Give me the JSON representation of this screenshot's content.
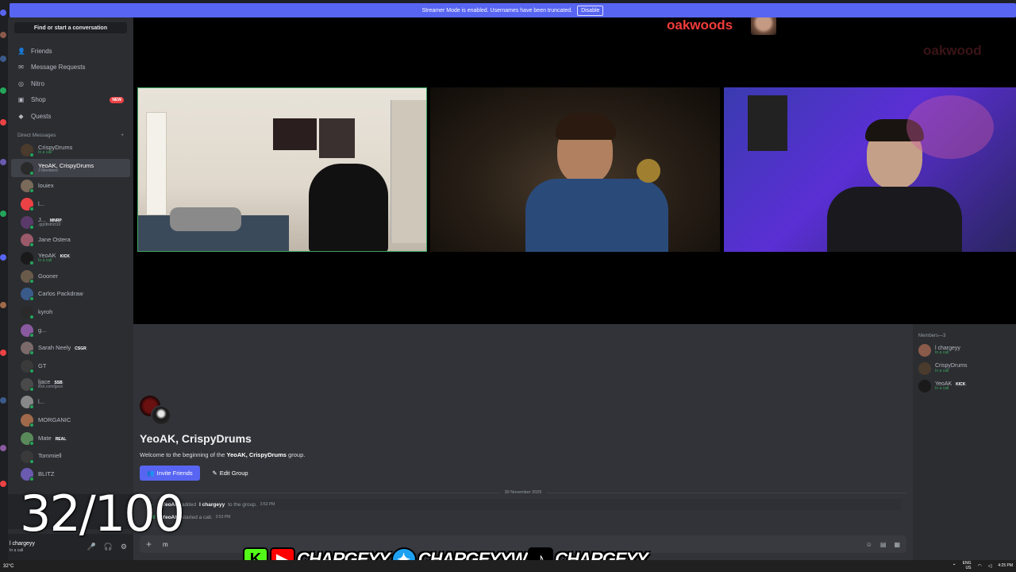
{
  "banner": {
    "text": "Streamer Mode is enabled. Usernames have been truncated.",
    "disable": "Disable"
  },
  "sidebar": {
    "search": "Find or start a conversation",
    "nav": [
      {
        "label": "Friends",
        "icon": "friends-icon"
      },
      {
        "label": "Message Requests",
        "icon": "mail-icon"
      },
      {
        "label": "Nitro",
        "icon": "nitro-icon"
      },
      {
        "label": "Shop",
        "icon": "shop-icon",
        "badge": "NEW"
      },
      {
        "label": "Quests",
        "icon": "quests-icon"
      }
    ],
    "dm_header": "Direct Messages",
    "dm_add": "+",
    "dms": [
      {
        "name": "CrispyDrums",
        "sub": "In a call",
        "color": "#4a3b2c"
      },
      {
        "name": "YeoAK, CrispyDrums",
        "sub": "3 Members",
        "color": "#2a2a2a"
      },
      {
        "name": "louiex",
        "sub": "",
        "color": "#7a6a5a"
      },
      {
        "name": "l...",
        "sub": "",
        "color": "#ed4245"
      },
      {
        "name": "J...",
        "tag": "MNRP",
        "sub": ".gg/district10",
        "color": "#5a3a6a"
      },
      {
        "name": "Jane Ostera",
        "sub": "",
        "color": "#9a5a6a"
      },
      {
        "name": "YeoAK",
        "tag": "KICK",
        "sub": "In a call",
        "color": "#1a1a1a"
      },
      {
        "name": "Gooner",
        "sub": "",
        "color": "#6a5a4a"
      },
      {
        "name": "Carlos Packdraw",
        "sub": "",
        "color": "#3a5a8a"
      },
      {
        "name": "kyroh",
        "sub": "",
        "color": "#2a2a2a"
      },
      {
        "name": "g...",
        "sub": "",
        "color": "#8a5aa0"
      },
      {
        "name": "Sarah Neely",
        "tag": "CSGR",
        "sub": "",
        "color": "#7a6a6a"
      },
      {
        "name": "GT",
        "sub": "",
        "color": "#3a3a3a"
      },
      {
        "name": "ljace",
        "tag": "SSB",
        "sub": "kick.com/jjace",
        "color": "#4a4a4a"
      },
      {
        "name": "l...",
        "sub": "",
        "color": "#888"
      },
      {
        "name": "MORGANIC",
        "sub": "",
        "color": "#a06a4a"
      },
      {
        "name": "Mate",
        "tag": "REAL",
        "sub": "",
        "color": "#5a8a5a"
      },
      {
        "name": "Tommiell",
        "sub": "",
        "color": "#3a3a3a"
      },
      {
        "name": "BLITZ",
        "sub": "",
        "color": "#6a5ab0"
      }
    ],
    "user": {
      "name": "l chargeyy",
      "status": "In a call"
    }
  },
  "video": {
    "overlay_name": "oakwoods",
    "overlay_name_2": "oakwood"
  },
  "chat": {
    "title": "YeoAK, CrispyDrums",
    "welcome_prefix": "Welcome to the beginning of the ",
    "welcome_group": "YeoAK, CrispyDrums",
    "welcome_suffix": " group.",
    "invite": "Invite Friends",
    "edit": "Edit Group",
    "date": "30 November 2025",
    "messages": [
      {
        "actor": "YeoAK",
        "action": " added ",
        "target": "l chargeyy",
        "rest": " to the group.",
        "time": "3:53 PM"
      },
      {
        "actor": "YeoAK",
        "action": " started a call.",
        "target": "",
        "rest": "",
        "time": "3:53 PM"
      }
    ],
    "composer": "m"
  },
  "members": {
    "header": "Members—3",
    "list": [
      {
        "name": "l chargeyy",
        "sub": "In a call",
        "color": "#8a5a4a"
      },
      {
        "name": "CrispyDrums",
        "sub": "In a call",
        "color": "#4a3b2c"
      },
      {
        "name": "YeoAK",
        "tag": "KICK",
        "sub": "In a call",
        "color": "#1a1a1a"
      }
    ]
  },
  "overlay": {
    "counter": "32/100",
    "handles": [
      "CHARGEYY",
      "CHARGEYYW",
      "CHARGEYY"
    ]
  },
  "taskbar": {
    "temp": "32°C",
    "lang": "ENG",
    "lang2": "US",
    "time": "4:25 PM"
  }
}
